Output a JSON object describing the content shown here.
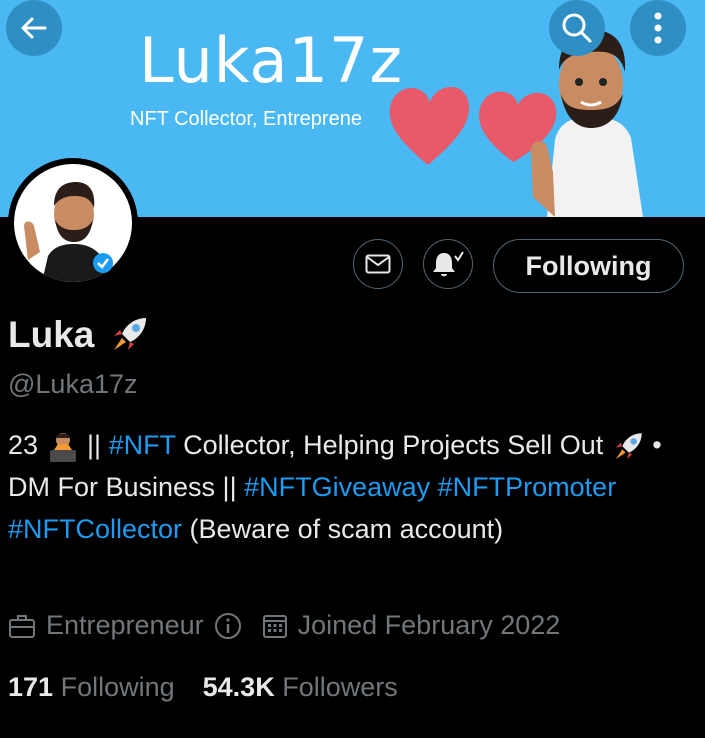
{
  "banner": {
    "title": "Luka17z",
    "subtitle": "NFT Collector, Entreprene"
  },
  "nav": {
    "back_icon": "arrow-left-icon",
    "search_icon": "search-icon",
    "more_icon": "more-vertical-icon"
  },
  "actions": {
    "message_icon": "mail-icon",
    "notify_icon": "bell-check-icon",
    "follow_label": "Following"
  },
  "profile": {
    "name": "Luka",
    "handle": "@Luka17z",
    "verified": true
  },
  "bio": {
    "p1": "23 ",
    "p2": " || ",
    "tag1": "#NFT",
    "p3": " Collector, Helping Projects Sell Out ",
    "p4": " • DM For Business || ",
    "tag2": "#NFTGiveaway",
    "tag3": "#NFTPromoter",
    "tag4": "#NFTCollector",
    "p5": "   (Beware of scam account)"
  },
  "meta": {
    "category": "Entrepreneur",
    "joined": "Joined February 2022"
  },
  "stats": {
    "following_count": "171",
    "following_label": "Following",
    "followers_count": "54.3K",
    "followers_label": "Followers"
  },
  "colors": {
    "banner": "#49b8f3",
    "link": "#1d9bf0",
    "muted": "#71767b",
    "text": "#e7e9ea"
  }
}
